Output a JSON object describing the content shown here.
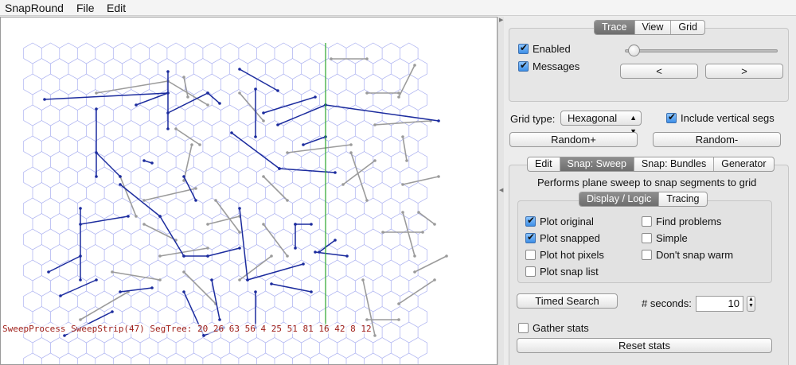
{
  "menubar": {
    "app_name": "SnapRound",
    "file": "File",
    "edit": "Edit"
  },
  "canvas": {
    "status_text": "SweepProcess SweepStrip(47) SegTree: 20 26 63 56 4 25 51 81 16 42 8 12",
    "colors": {
      "grid": "#a9aff0",
      "snapped": "#1c2c9e",
      "original": "#9b9b9b",
      "sweep_line": "#2aa52a",
      "status": "#a0201a"
    }
  },
  "trace_panel": {
    "tabs": [
      "Trace",
      "View",
      "Grid"
    ],
    "active_tab": "Trace",
    "enabled": {
      "label": "Enabled",
      "checked": true
    },
    "messages": {
      "label": "Messages",
      "checked": true
    },
    "slider_value": 0.02,
    "prev_label": "<",
    "next_label": ">"
  },
  "grid_controls": {
    "grid_type_label": "Grid type:",
    "grid_type_value": "Hexagonal",
    "include_vertical": {
      "label": "Include vertical segs",
      "checked": true
    },
    "random_plus": "Random+",
    "random_minus": "Random-"
  },
  "mode_tabs": {
    "tabs": [
      "Edit",
      "Snap: Sweep",
      "Snap: Bundles",
      "Generator"
    ],
    "active_tab": "Snap: Sweep"
  },
  "sweep_panel": {
    "description": "Performs plane sweep to snap segments to grid",
    "subtabs": [
      "Display / Logic",
      "Tracing"
    ],
    "active_subtab": "Display / Logic",
    "options_left": [
      {
        "label": "Plot original",
        "checked": true
      },
      {
        "label": "Plot snapped",
        "checked": true
      },
      {
        "label": "Plot hot pixels",
        "checked": false
      },
      {
        "label": "Plot snap list",
        "checked": false
      }
    ],
    "options_right": [
      {
        "label": "Find problems",
        "checked": false
      },
      {
        "label": "Simple",
        "checked": false
      },
      {
        "label": "Don't snap warm",
        "checked": false
      }
    ],
    "timed_search_label": "Timed Search",
    "seconds_label": "# seconds:",
    "seconds_value": "10",
    "gather_stats": {
      "label": "Gather stats",
      "checked": false
    },
    "reset_stats_label": "Reset stats"
  }
}
